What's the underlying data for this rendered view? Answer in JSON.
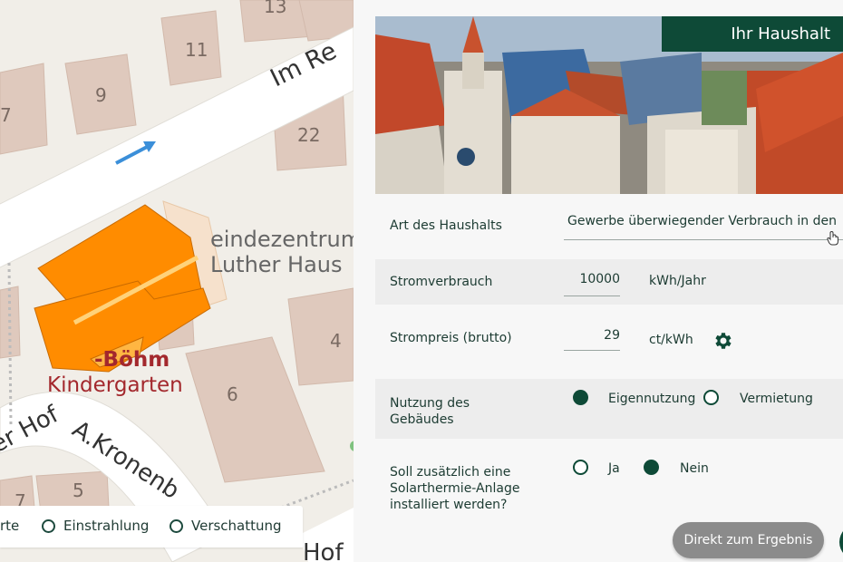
{
  "map": {
    "street_labels": [
      "Im Re",
      "er Hof",
      "A.Kronenb",
      "Hof"
    ],
    "house_numbers": [
      "13",
      "11",
      "9",
      "7",
      "22",
      "4",
      "6",
      "5",
      "7"
    ],
    "poi_labels": [
      "eindezentrum M",
      "Luther Haus",
      "-Böhm",
      "Kindergarten"
    ],
    "legend": {
      "options": [
        "rte",
        "Einstrahlung",
        "Verschattung"
      ]
    }
  },
  "panel": {
    "hero_title": "Ihr Haushalt",
    "household_type_label": "Art des Haushalts",
    "household_type_value": "Gewerbe überwiegender Verbrauch in den",
    "power_consumption_label": "Stromverbrauch",
    "power_consumption_value": "10000",
    "power_consumption_unit": "kWh/Jahr",
    "power_price_label": "Strompreis (brutto)",
    "power_price_value": "29",
    "power_price_unit": "ct/kWh",
    "usage_label_1": "Nutzung des",
    "usage_label_2": "Gebäudes",
    "usage_option_own": "Eigennutzung",
    "usage_option_rent": "Vermietung",
    "solar_label_1": "Soll zusätzlich eine",
    "solar_label_2": "Solarthermie-Anlage",
    "solar_label_3": "installiert werden?",
    "solar_option_yes": "Ja",
    "solar_option_no": "Nein",
    "direct_result_button": "Direkt zum Ergebnis"
  },
  "colors": {
    "brand_green": "#0e4a37",
    "building_orange": "#ff8c00",
    "button_gray": "#8b8b8b"
  }
}
